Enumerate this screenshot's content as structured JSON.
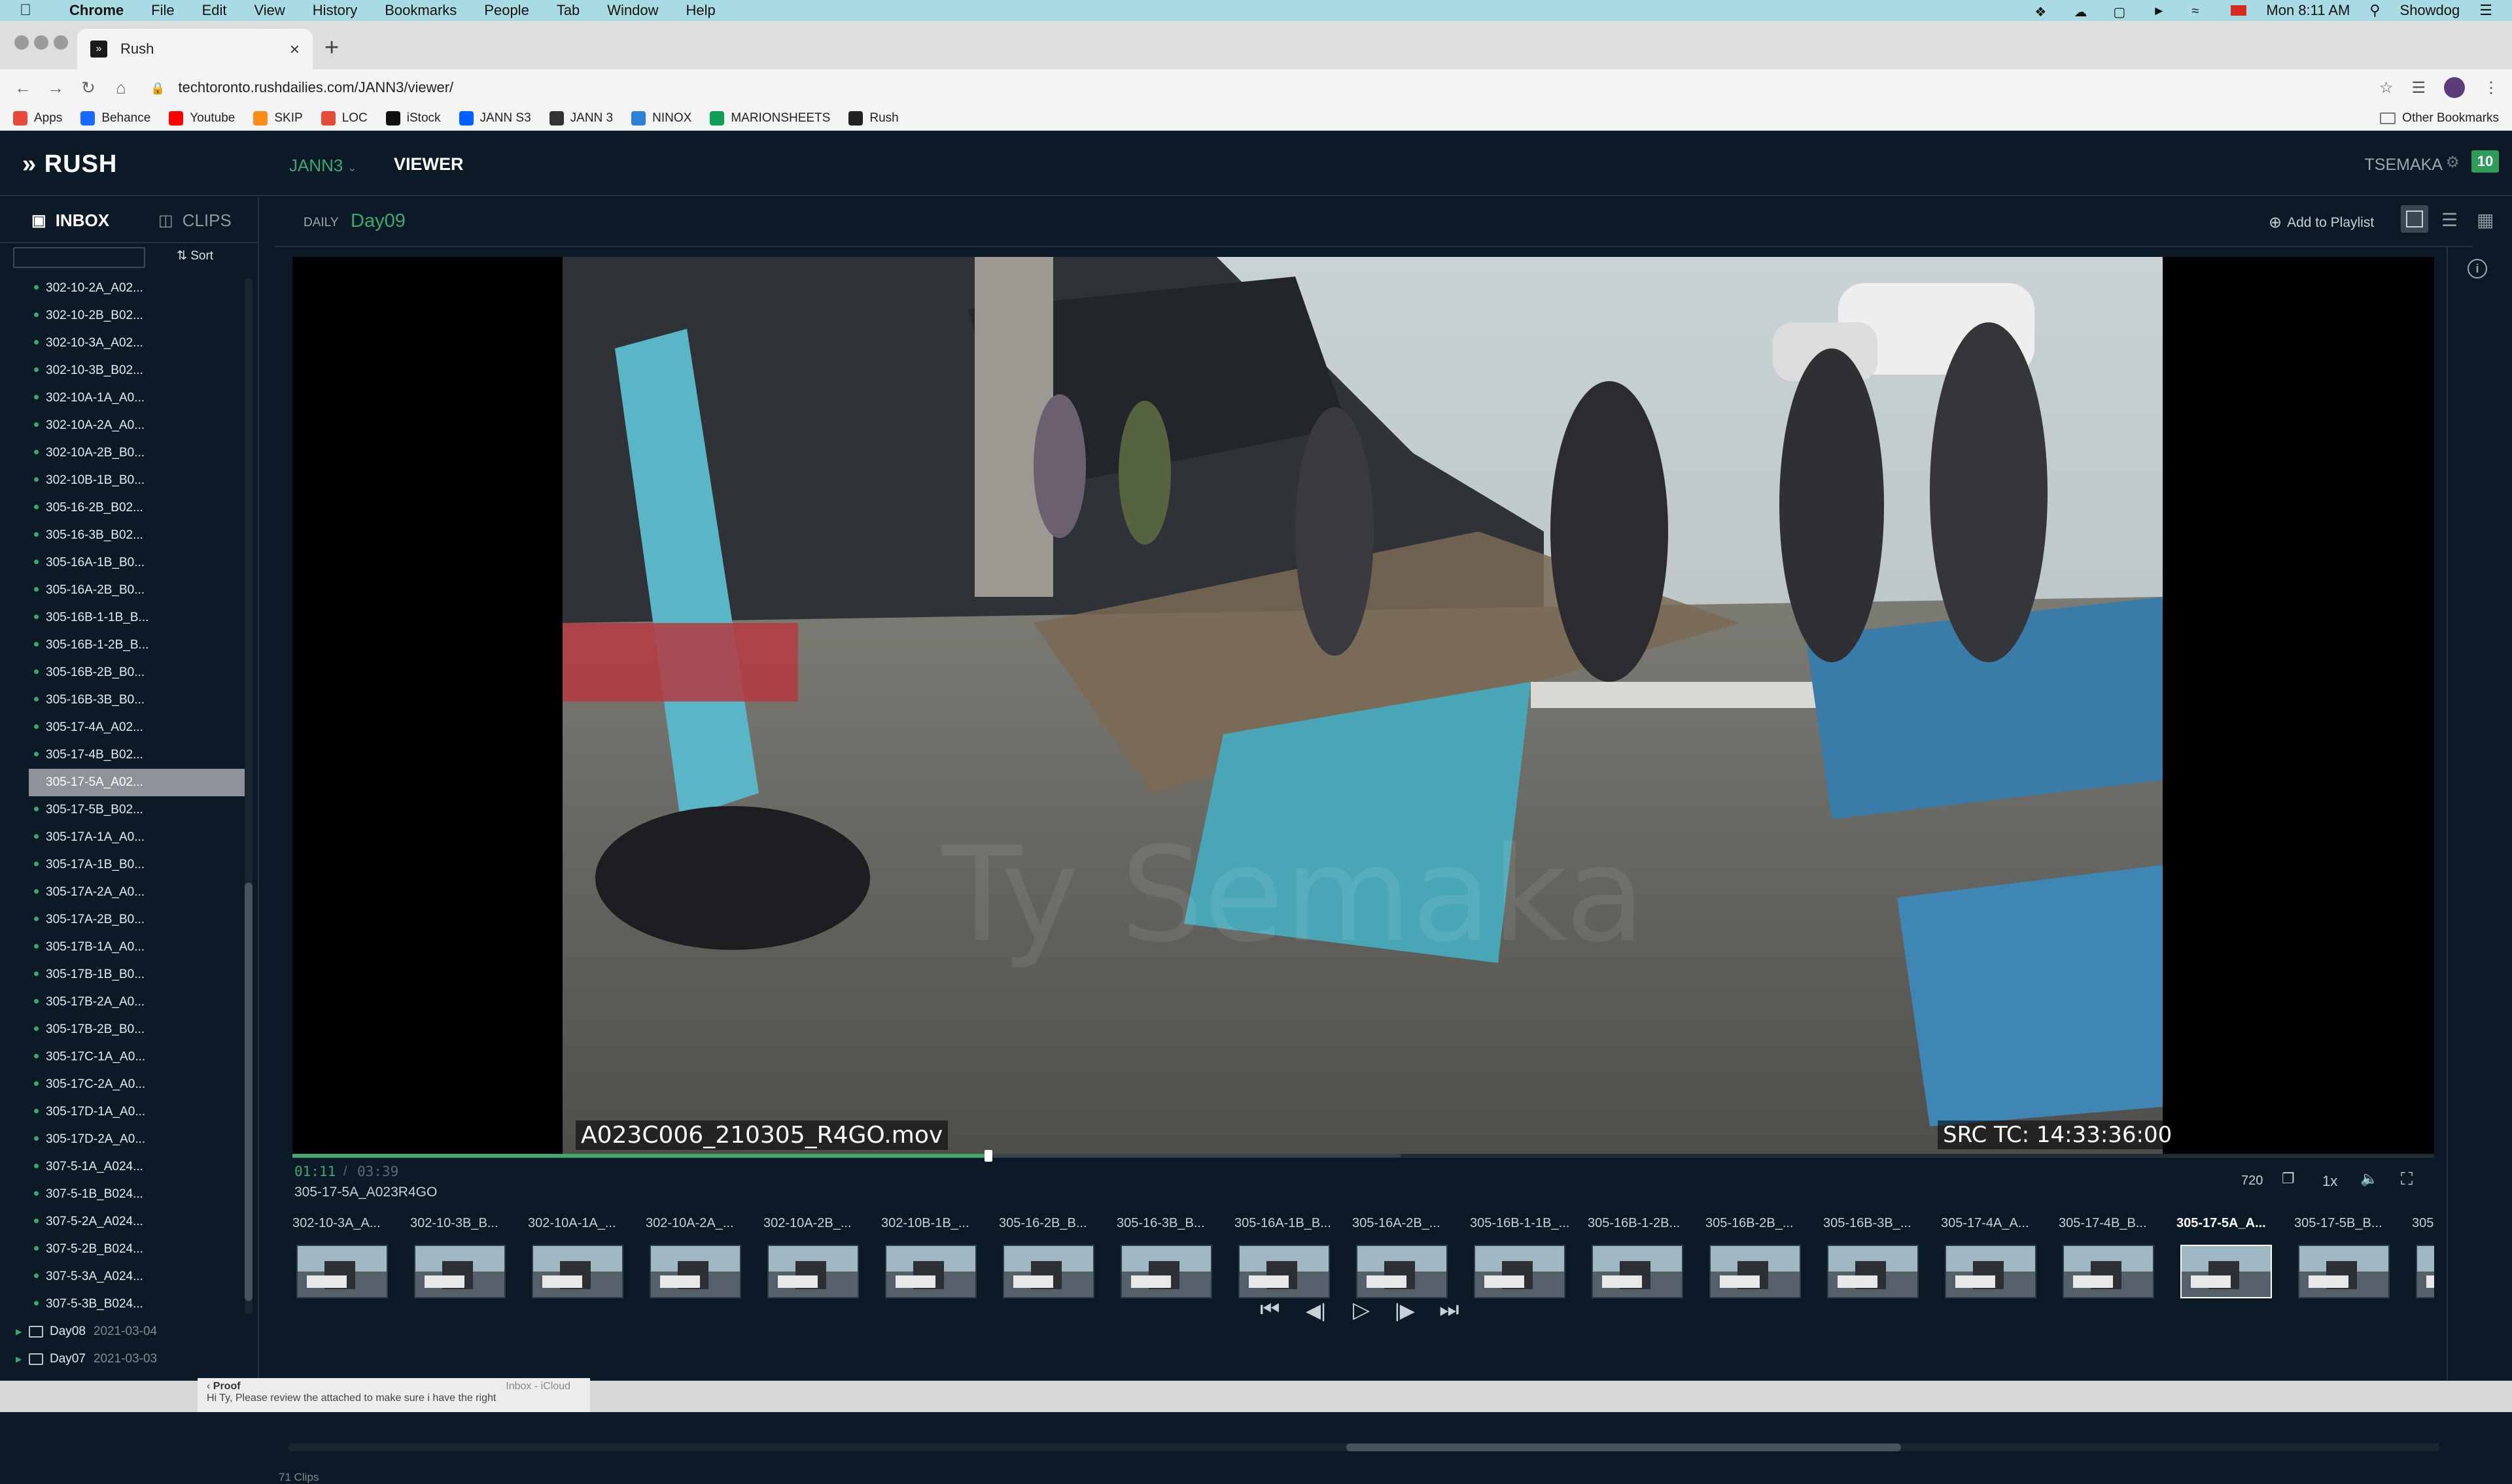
{
  "menubar": {
    "app": "Chrome",
    "items": [
      "File",
      "Edit",
      "View",
      "History",
      "Bookmarks",
      "People",
      "Tab",
      "Window",
      "Help"
    ],
    "clock": "Mon 8:11 AM",
    "user": "Showdog"
  },
  "browser": {
    "tab_title": "Rush",
    "url": "techtoronto.rushdailies.com/JANN3/viewer/",
    "bookmarks": [
      {
        "label": "Apps",
        "icon": "apps-grid-icon",
        "color": "#e64a3b"
      },
      {
        "label": "Behance",
        "icon": "behance-icon",
        "color": "#1769ff"
      },
      {
        "label": "Youtube",
        "icon": "youtube-icon",
        "color": "#ff0000"
      },
      {
        "label": "SKIP",
        "icon": "skip-icon",
        "color": "#ff8c1a"
      },
      {
        "label": "LOC",
        "icon": "loc-icon",
        "color": "#e64a3b"
      },
      {
        "label": "iStock",
        "icon": "istock-icon",
        "color": "#111111"
      },
      {
        "label": "JANN S3",
        "icon": "dropbox-icon",
        "color": "#0061ff"
      },
      {
        "label": "JANN 3",
        "icon": "slate-icon",
        "color": "#333333"
      },
      {
        "label": "NINOX",
        "icon": "ninox-icon",
        "color": "#2f7fd8"
      },
      {
        "label": "MARIONSHEETS",
        "icon": "sheets-icon",
        "color": "#0f9d58"
      },
      {
        "label": "Rush",
        "icon": "rush-icon",
        "color": "#222222"
      }
    ],
    "other_bookmarks": "Other Bookmarks"
  },
  "app": {
    "logo": "RUSH",
    "project": "JANN3",
    "view": "VIEWER",
    "user": "TSEMAKA",
    "notification_count": "10",
    "accent": "#3fa870"
  },
  "sidebar": {
    "tabs": {
      "inbox": "INBOX",
      "clips": "CLIPS"
    },
    "search_placeholder": "",
    "sort": "Sort",
    "clips": [
      "302-10-2A_A02...",
      "302-10-2B_B02...",
      "302-10-3A_A02...",
      "302-10-3B_B02...",
      "302-10A-1A_A0...",
      "302-10A-2A_A0...",
      "302-10A-2B_B0...",
      "302-10B-1B_B0...",
      "305-16-2B_B02...",
      "305-16-3B_B02...",
      "305-16A-1B_B0...",
      "305-16A-2B_B0...",
      "305-16B-1-1B_B...",
      "305-16B-1-2B_B...",
      "305-16B-2B_B0...",
      "305-16B-3B_B0...",
      "305-17-4A_A02...",
      "305-17-4B_B02...",
      "305-17-5A_A02...",
      "305-17-5B_B02...",
      "305-17A-1A_A0...",
      "305-17A-1B_B0...",
      "305-17A-2A_A0...",
      "305-17A-2B_B0...",
      "305-17B-1A_A0...",
      "305-17B-1B_B0...",
      "305-17B-2A_A0...",
      "305-17B-2B_B0...",
      "305-17C-1A_A0...",
      "305-17C-2A_A0...",
      "305-17D-1A_A0...",
      "305-17D-2A_A0...",
      "307-5-1A_A024...",
      "307-5-1B_B024...",
      "307-5-2A_A024...",
      "307-5-2B_B024...",
      "307-5-3A_A024...",
      "307-5-3B_B024..."
    ],
    "selected_index": 18,
    "days": [
      {
        "name": "Day08",
        "date": "2021-03-04"
      },
      {
        "name": "Day07",
        "date": "2021-03-03"
      }
    ]
  },
  "viewer": {
    "daily_label": "DAILY",
    "day": "Day09",
    "add_to_playlist": "Add to Playlist",
    "filename": "A023C006_210305_R4GO.mov",
    "src_tc": "SRC TC: 14:33:36:00",
    "time_current": "01:11",
    "time_total": "03:39",
    "time_sep": "/",
    "progress": 0.325,
    "current_clip": "305-17-5A_A023R4GO",
    "resolution": "720",
    "speed": "1x",
    "watermark": "Ty Semaka"
  },
  "filmstrip": {
    "items": [
      "302-10-3A_A...",
      "302-10-3B_B...",
      "302-10A-1A_...",
      "302-10A-2A_...",
      "302-10A-2B_...",
      "302-10B-1B_...",
      "305-16-2B_B...",
      "305-16-3B_B...",
      "305-16A-1B_B...",
      "305-16A-2B_...",
      "305-16B-1-1B_...",
      "305-16B-1-2B...",
      "305-16B-2B_...",
      "305-16B-3B_...",
      "305-17-4A_A...",
      "305-17-4B_B...",
      "305-17-5A_A...",
      "305-17-5B_B...",
      "305..."
    ],
    "current_index": 16,
    "clip_count": "71 Clips"
  },
  "notice": {
    "from": "Proof",
    "source": "Inbox - iCloud",
    "text": "Hi Ty, Please review the attached to make sure i have the right"
  }
}
